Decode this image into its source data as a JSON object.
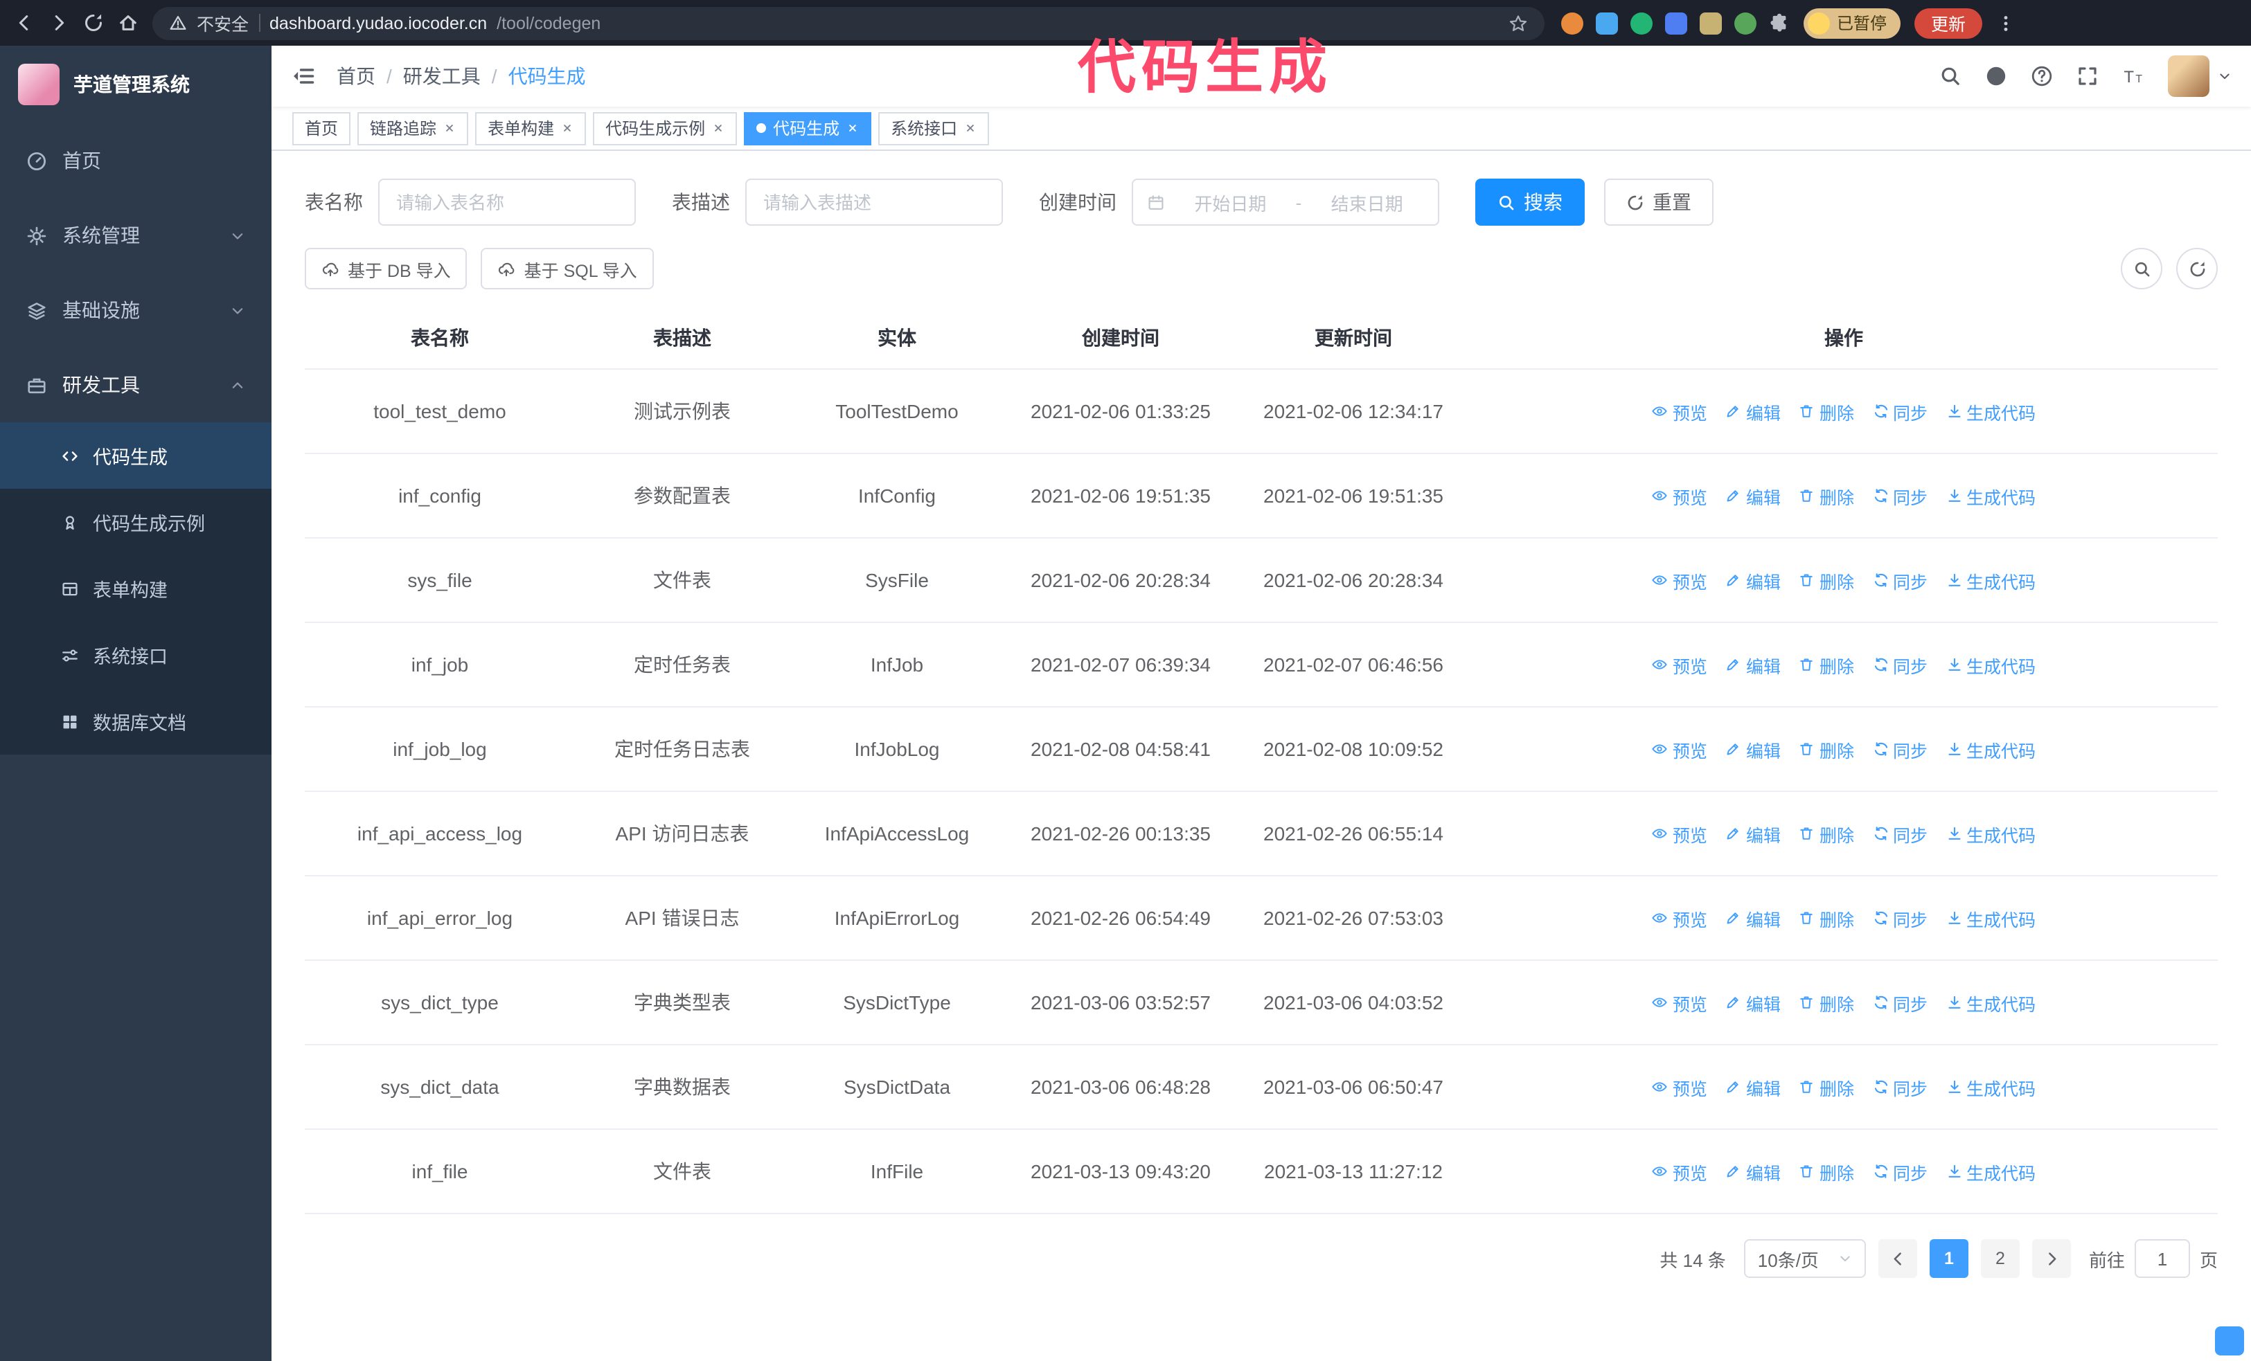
{
  "colors": {
    "accent": "#409eff",
    "primary": "#1890ff",
    "overlay": "#fb4a6b",
    "chrome_bg": "#1d212b",
    "sidebar_bg": "#2d3a4b",
    "submenu_bg": "#202d3c",
    "update_red": "#d5493d",
    "paused_bg": "#dfc08b"
  },
  "browser": {
    "security_label": "不安全",
    "url_host": "dashboard.yudao.iocoder.cn",
    "url_path": "/tool/codegen",
    "paused_badge": "已暂停",
    "update_label": "更新"
  },
  "overlay": {
    "title": "代码生成"
  },
  "sidebar": {
    "logo_title": "芋道管理系统",
    "items": [
      {
        "label": "首页"
      },
      {
        "label": "系统管理"
      },
      {
        "label": "基础设施"
      },
      {
        "label": "研发工具"
      }
    ],
    "submenu": [
      {
        "label": "代码生成"
      },
      {
        "label": "代码生成示例"
      },
      {
        "label": "表单构建"
      },
      {
        "label": "系统接口"
      },
      {
        "label": "数据库文档"
      }
    ]
  },
  "header": {
    "breadcrumb": [
      "首页",
      "研发工具",
      "代码生成"
    ],
    "separator": "/"
  },
  "tabs": [
    {
      "label": "首页"
    },
    {
      "label": "链路追踪"
    },
    {
      "label": "表单构建"
    },
    {
      "label": "代码生成示例"
    },
    {
      "label": "代码生成"
    },
    {
      "label": "系统接口"
    }
  ],
  "filters": {
    "table_name_label": "表名称",
    "table_name_placeholder": "请输入表名称",
    "table_desc_label": "表描述",
    "table_desc_placeholder": "请输入表描述",
    "create_time_label": "创建时间",
    "start_date_placeholder": "开始日期",
    "range_separator": "-",
    "end_date_placeholder": "结束日期",
    "search_label": "搜索",
    "reset_label": "重置"
  },
  "toolbar": {
    "import_db": "基于 DB 导入",
    "import_sql": "基于 SQL 导入"
  },
  "table": {
    "columns": [
      "表名称",
      "表描述",
      "实体",
      "创建时间",
      "更新时间",
      "操作"
    ],
    "actions": [
      "预览",
      "编辑",
      "删除",
      "同步",
      "生成代码"
    ],
    "rows": [
      {
        "name": "tool_test_demo",
        "desc": "测试示例表",
        "entity": "ToolTestDemo",
        "created": "2021-02-06 01:33:25",
        "updated": "2021-02-06 12:34:17"
      },
      {
        "name": "inf_config",
        "desc": "参数配置表",
        "entity": "InfConfig",
        "created": "2021-02-06 19:51:35",
        "updated": "2021-02-06 19:51:35"
      },
      {
        "name": "sys_file",
        "desc": "文件表",
        "entity": "SysFile",
        "created": "2021-02-06 20:28:34",
        "updated": "2021-02-06 20:28:34"
      },
      {
        "name": "inf_job",
        "desc": "定时任务表",
        "entity": "InfJob",
        "created": "2021-02-07 06:39:34",
        "updated": "2021-02-07 06:46:56"
      },
      {
        "name": "inf_job_log",
        "desc": "定时任务日志表",
        "entity": "InfJobLog",
        "created": "2021-02-08 04:58:41",
        "updated": "2021-02-08 10:09:52"
      },
      {
        "name": "inf_api_access_log",
        "desc": "API 访问日志表",
        "entity": "InfApiAccessLog",
        "created": "2021-02-26 00:13:35",
        "updated": "2021-02-26 06:55:14"
      },
      {
        "name": "inf_api_error_log",
        "desc": "API 错误日志",
        "entity": "InfApiErrorLog",
        "created": "2021-02-26 06:54:49",
        "updated": "2021-02-26 07:53:03"
      },
      {
        "name": "sys_dict_type",
        "desc": "字典类型表",
        "entity": "SysDictType",
        "created": "2021-03-06 03:52:57",
        "updated": "2021-03-06 04:03:52"
      },
      {
        "name": "sys_dict_data",
        "desc": "字典数据表",
        "entity": "SysDictData",
        "created": "2021-03-06 06:48:28",
        "updated": "2021-03-06 06:50:47"
      },
      {
        "name": "inf_file",
        "desc": "文件表",
        "entity": "InfFile",
        "created": "2021-03-13 09:43:20",
        "updated": "2021-03-13 11:27:12"
      }
    ]
  },
  "pagination": {
    "total": "共 14 条",
    "page_size": "10条/页",
    "pages": [
      "1",
      "2"
    ],
    "goto_label": "前往",
    "goto_value": "1",
    "page_unit": "页"
  }
}
